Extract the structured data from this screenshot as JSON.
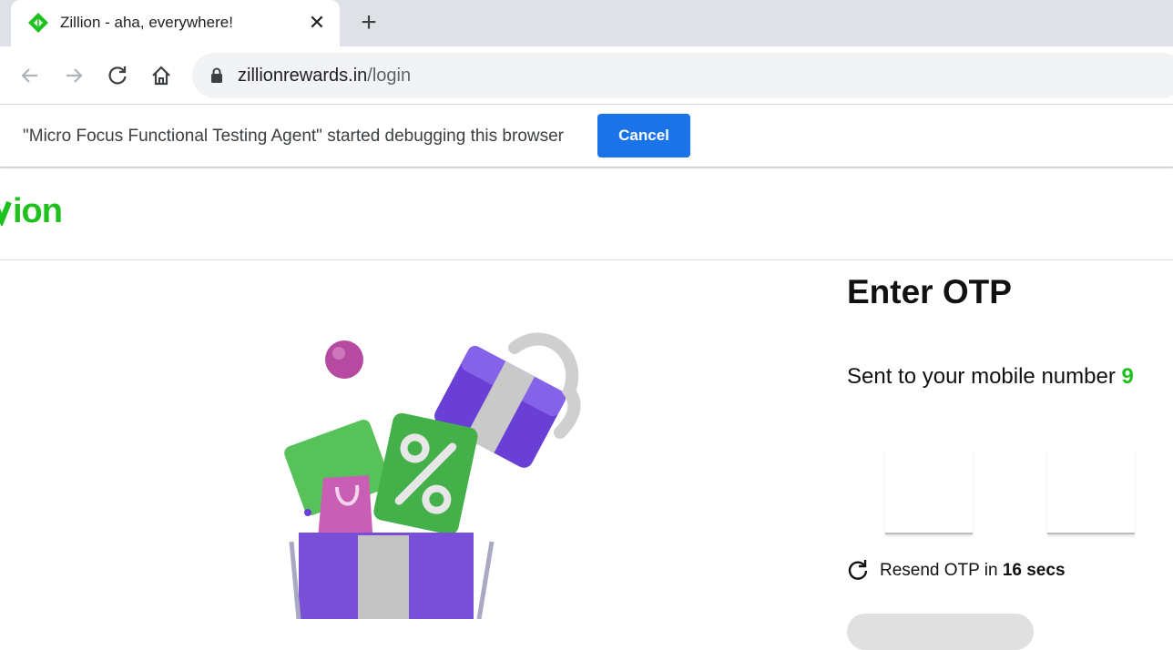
{
  "browser": {
    "tab": {
      "title": "Zillion - aha, everywhere!",
      "close_glyph": "✕"
    },
    "new_tab_glyph": "+",
    "url": {
      "host": "zillionrewards.in",
      "path": "/login"
    }
  },
  "infobar": {
    "message": "\"Micro Focus Functional Testing Agent\" started debugging this browser",
    "cancel_label": "Cancel"
  },
  "page": {
    "logo_text": "ion",
    "otp_title": "Enter OTP",
    "sent_to_label": "Sent to your mobile number ",
    "mobile_number_visible": "9",
    "resend_prefix": "Resend OTP in ",
    "resend_countdown": "16 secs"
  },
  "colors": {
    "brand_green": "#1ec11e",
    "button_blue": "#1a73e8"
  },
  "icons": [
    "zillion-favicon-icon",
    "back-icon",
    "forward-icon",
    "reload-icon",
    "home-icon",
    "lock-icon",
    "resend-icon"
  ]
}
